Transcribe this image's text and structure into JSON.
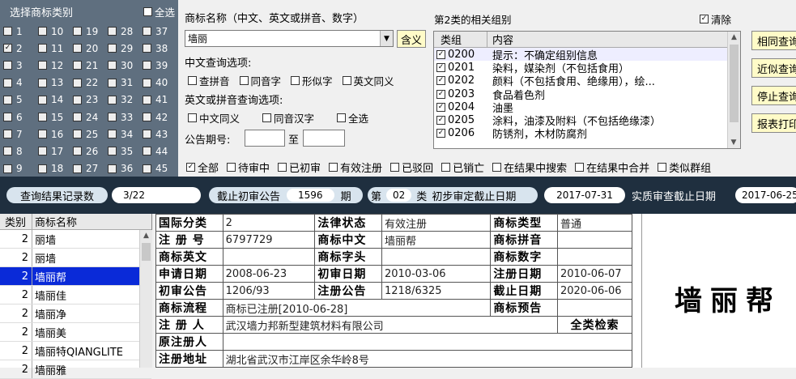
{
  "class_panel": {
    "title": "选择商标类别",
    "select_all": "全选",
    "classes": [
      "1",
      "10",
      "19",
      "28",
      "37",
      "2",
      "11",
      "20",
      "29",
      "38",
      "3",
      "12",
      "21",
      "30",
      "39",
      "4",
      "13",
      "22",
      "31",
      "40",
      "5",
      "14",
      "23",
      "32",
      "41",
      "6",
      "15",
      "24",
      "33",
      "42",
      "7",
      "16",
      "25",
      "34",
      "43",
      "8",
      "17",
      "26",
      "35",
      "44",
      "9",
      "18",
      "27",
      "36",
      "45"
    ],
    "checked": [
      "2"
    ]
  },
  "query": {
    "name_label": "商标名称（中文、英文或拼音、数字）",
    "name_value": "墙丽",
    "contains_button": "含义",
    "cn_options_label": "中文查询选项:",
    "cn_options": [
      "查拼音",
      "同音字",
      "形似字",
      "英文同义"
    ],
    "en_options_label": "英文或拼音查询选项:",
    "en_options": [
      "中文同义",
      "同音汉字",
      "全选"
    ],
    "period_label": "公告期号:",
    "period_to": "至"
  },
  "groups": {
    "title": "第2类的相关组别",
    "clear_label": "清除",
    "col_group": "类组",
    "col_content": "内容",
    "rows": [
      {
        "code": "0200",
        "content": "提示：不确定组别信息"
      },
      {
        "code": "0201",
        "content": "染料，媒染剂（不包括食用）"
      },
      {
        "code": "0202",
        "content": "颜料（不包括食用、绝缘用），绘..."
      },
      {
        "code": "0203",
        "content": "食品着色剂"
      },
      {
        "code": "0204",
        "content": "油墨"
      },
      {
        "code": "0205",
        "content": "涂料，油漆及附料（不包括绝缘漆）"
      },
      {
        "code": "0206",
        "content": "防锈剂，木材防腐剂"
      }
    ]
  },
  "buttons": [
    "相同查询",
    "近似查询",
    "停止查询",
    "报表打印"
  ],
  "status_filter": [
    "全部",
    "待审中",
    "已初审",
    "有效注册",
    "已驳回",
    "已销亡",
    "在结果中搜索",
    "在结果中合并",
    "类似群组"
  ],
  "bar": {
    "records_label": "查询结果记录数",
    "records_value": "3/22",
    "deadline_label": "截止初审公告",
    "deadline_value": "1596",
    "deadline_unit": "期",
    "class_prefix": "第",
    "class_value": "02",
    "class_suffix": "类",
    "prelim_label": "初步审定截止日期",
    "prelim_value": "2017-07-31",
    "exam_label": "实质审查截止日期",
    "exam_value": "2017-06-25"
  },
  "results": {
    "col_cat": "类别",
    "col_name": "商标名称",
    "rows": [
      {
        "cat": "2",
        "name": "丽墙"
      },
      {
        "cat": "2",
        "name": "丽墙"
      },
      {
        "cat": "2",
        "name": "墙丽帮"
      },
      {
        "cat": "2",
        "name": "墙丽佳"
      },
      {
        "cat": "2",
        "name": "墙丽净"
      },
      {
        "cat": "2",
        "name": "墙丽美"
      },
      {
        "cat": "2",
        "name": "墙丽特QIANGLITE"
      },
      {
        "cat": "2",
        "name": "墙丽雅"
      }
    ],
    "selected_index": 2
  },
  "detail": {
    "intl_class_k": "国际分类",
    "intl_class_v": "2",
    "legal_k": "法律状态",
    "legal_v": "有效注册",
    "type_k": "商标类型",
    "type_v": "普通",
    "regno_k": "注 册 号",
    "regno_v": "6797729",
    "cn_k": "商标中文",
    "cn_v": "墙丽帮",
    "pinyin_k": "商标拼音",
    "pinyin_v": "",
    "en_k": "商标英文",
    "en_v": "",
    "head_k": "商标字头",
    "head_v": "",
    "num_k": "商标数字",
    "num_v": "",
    "apply_k": "申请日期",
    "apply_v": "2008-06-23",
    "prelim_k": "初审日期",
    "prelim_v": "2010-03-06",
    "regdate_k": "注册日期",
    "regdate_v": "2010-06-07",
    "prelimpub_k": "初审公告",
    "prelimpub_v": "1206/93",
    "regpub_k": "注册公告",
    "regpub_v": "1218/6325",
    "end_k": "截止日期",
    "end_v": "2020-06-06",
    "flow_k": "商标流程",
    "flow_v": "商标已注册[2010-06-28]",
    "warn_k": "商标预告",
    "warn_v": "",
    "owner_k": "注 册 人",
    "owner_v": "武汉墙力邦新型建筑材料有限公司",
    "allclass": "全类检索",
    "orig_k": "原注册人",
    "orig_v": "",
    "addr_k": "注册地址",
    "addr_v": "湖北省武汉市江岸区余华岭8号"
  },
  "mark_image_text": "墙丽帮"
}
